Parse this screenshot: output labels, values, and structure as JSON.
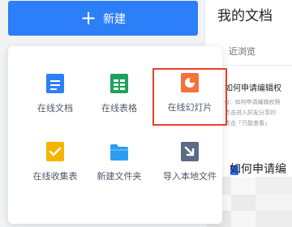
{
  "header": {
    "new_button_icon": "plus-icon",
    "new_button_label": "新建"
  },
  "right_panel": {
    "title": "我的文档",
    "recent_label": "近浏览",
    "doc_card": {
      "title": "如何申请编辑权",
      "line1": "Q：如何申请编辑权限",
      "line2": "点击进入好友分享的",
      "line3": "点击「只能查看」"
    },
    "doc2_title": "如何申请编"
  },
  "menu": {
    "items": [
      {
        "label": "在线文档",
        "icon": "online-doc-icon",
        "color": "#2d7ff9"
      },
      {
        "label": "在线表格",
        "icon": "online-sheet-icon",
        "color": "#1fa15b"
      },
      {
        "label": "在线幻灯片",
        "icon": "online-slides-icon",
        "color": "#f5733b",
        "selected": true
      },
      {
        "label": "在线收集表",
        "icon": "online-form-icon",
        "color": "#f5b400"
      },
      {
        "label": "新建文件夹",
        "icon": "new-folder-icon",
        "color": "#2d9cf0"
      },
      {
        "label": "导入本地文件",
        "icon": "import-local-file-icon",
        "color": "#5b6b85"
      }
    ]
  },
  "colors": {
    "accent": "#2d7ff9",
    "highlight_border": "#e8402a"
  }
}
